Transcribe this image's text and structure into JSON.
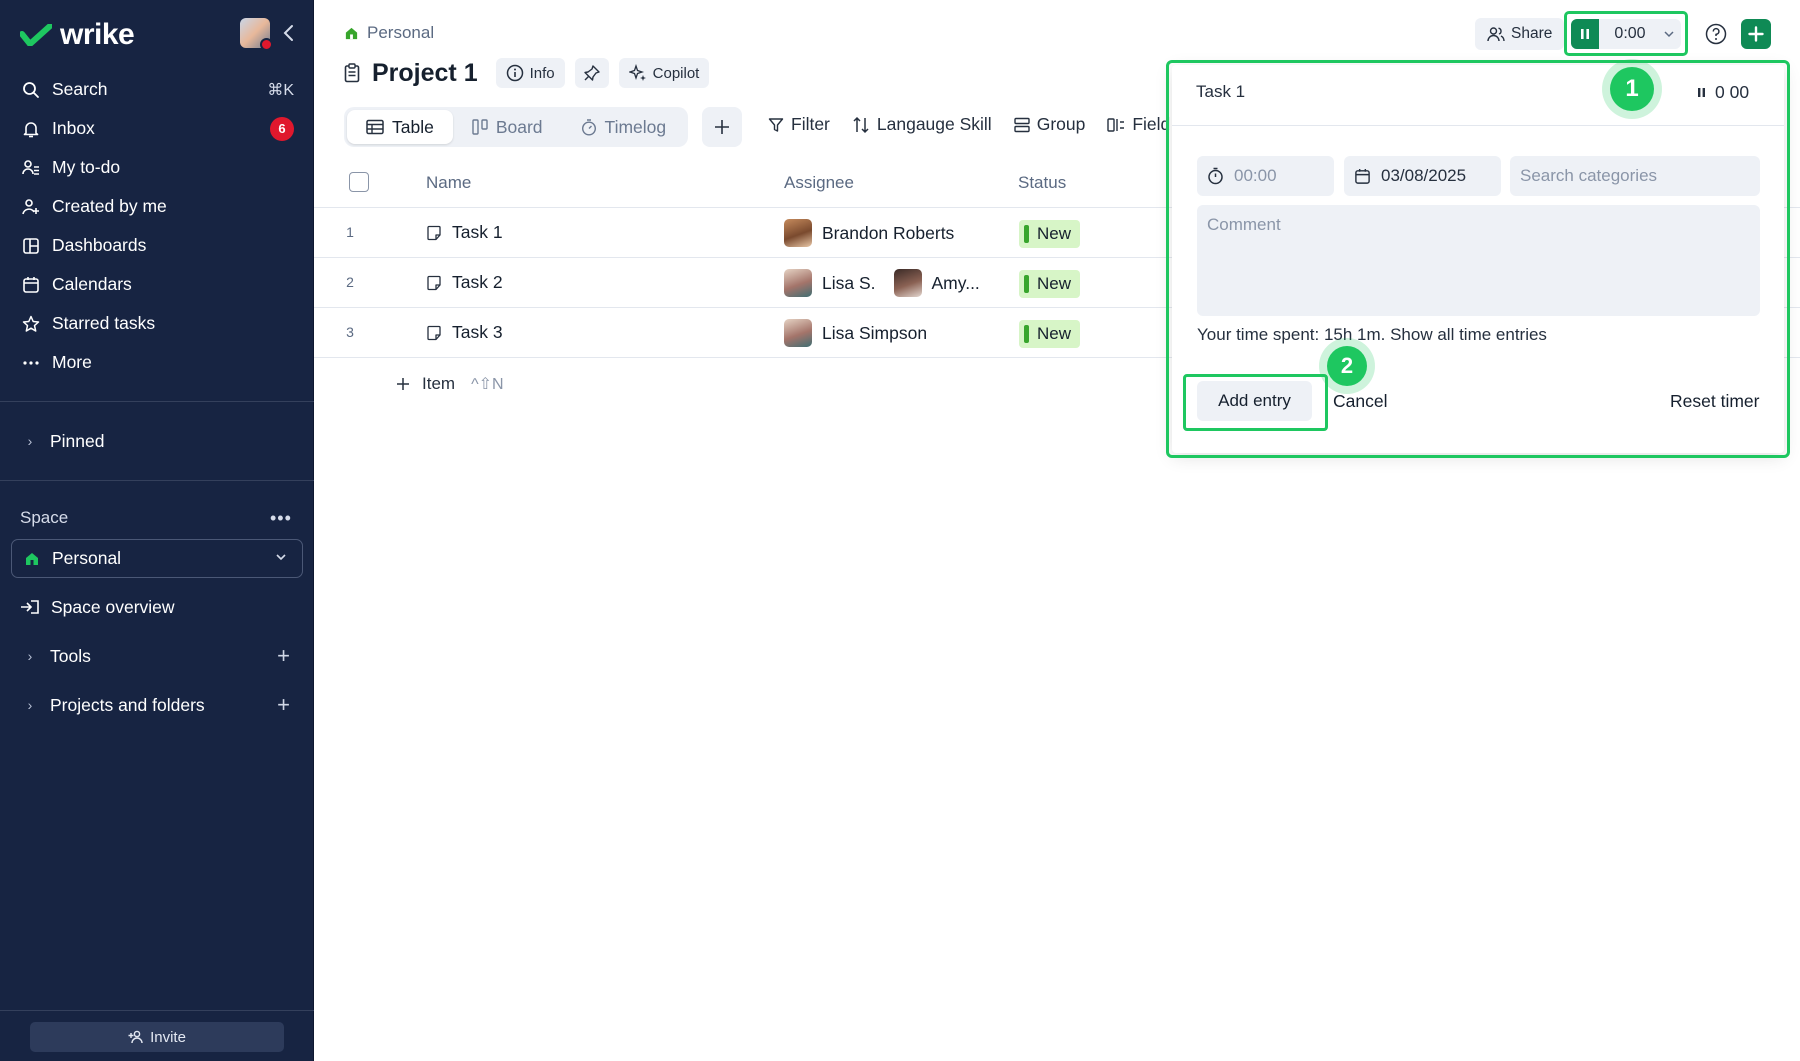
{
  "app": {
    "name": "wrike",
    "brand_color": "#1ec760",
    "accent_dark": "#0f8a55"
  },
  "sidebar": {
    "nav": [
      {
        "label": "Search",
        "icon": "search-icon",
        "shortcut": "⌘K"
      },
      {
        "label": "Inbox",
        "icon": "bell-icon",
        "badge": "6"
      },
      {
        "label": "My to-do",
        "icon": "todo-icon"
      },
      {
        "label": "Created by me",
        "icon": "user-plus-icon"
      },
      {
        "label": "Dashboards",
        "icon": "dashboard-icon"
      },
      {
        "label": "Calendars",
        "icon": "calendar-icon"
      },
      {
        "label": "Starred tasks",
        "icon": "star-icon"
      },
      {
        "label": "More",
        "icon": "ellipsis-icon"
      }
    ],
    "pinned_label": "Pinned",
    "space_label": "Space",
    "space_selected": "Personal",
    "space_overview": "Space overview",
    "tools_label": "Tools",
    "projects_label": "Projects and folders",
    "invite_label": "Invite"
  },
  "header": {
    "breadcrumb": "Personal",
    "project_title": "Project 1",
    "info_label": "Info",
    "copilot_label": "Copilot",
    "share_label": "Share",
    "timer_value": "0:00"
  },
  "views": {
    "tabs": [
      "Table",
      "Board",
      "Timelog"
    ],
    "active": "Table"
  },
  "toolbar": {
    "filter": "Filter",
    "sort": "Langauge Skill",
    "group": "Group",
    "fields": "Field"
  },
  "table": {
    "columns": {
      "name": "Name",
      "assignee": "Assignee",
      "status": "Status"
    },
    "rows": [
      {
        "num": "1",
        "name": "Task 1",
        "assignees": [
          "Brandon Roberts"
        ],
        "status": "New"
      },
      {
        "num": "2",
        "name": "Task 2",
        "assignees": [
          "Lisa S.",
          "Amy..."
        ],
        "status": "New"
      },
      {
        "num": "3",
        "name": "Task 3",
        "assignees": [
          "Lisa Simpson"
        ],
        "status": "New"
      }
    ],
    "add_item_label": "Item",
    "add_item_shortcut": "^⇧N"
  },
  "popover": {
    "task_name": "Task 1",
    "timer_display": "0 00",
    "duration_placeholder": "00:00",
    "date_value": "03/08/2025",
    "category_placeholder": "Search categories",
    "comment_placeholder": "Comment",
    "time_spent_text": "Your time spent: 15h 1m. Show all time entries",
    "add_entry_label": "Add entry",
    "cancel_label": "Cancel",
    "reset_label": "Reset timer"
  },
  "annotations": {
    "step1": "1",
    "step2": "2"
  }
}
